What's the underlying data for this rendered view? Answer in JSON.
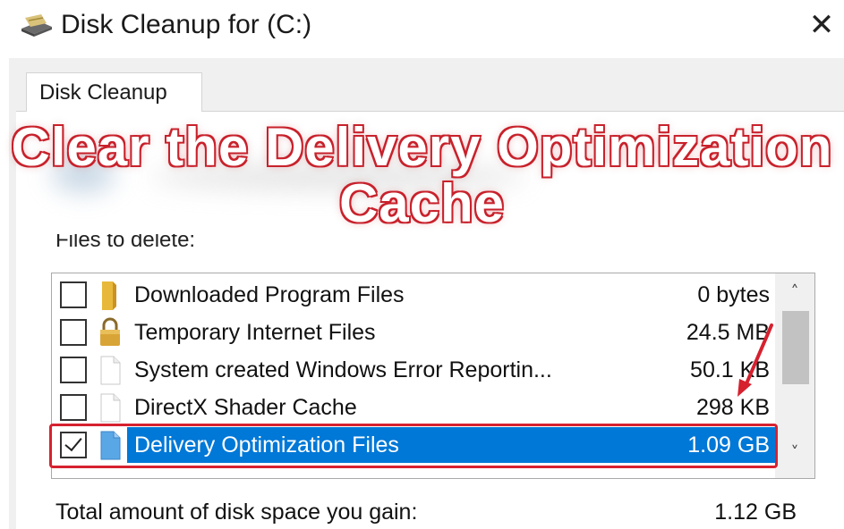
{
  "window": {
    "title": "Disk Cleanup for  (C:)",
    "close_glyph": "✕",
    "app_icon": "disk-cleanup-icon"
  },
  "tab": {
    "label": "Disk Cleanup"
  },
  "overlay": {
    "line1": "Clear the Delivery Optimization",
    "line2": "Cache",
    "stroke_color": "#c8222c"
  },
  "files_to_delete_label": "Files to delete:",
  "files": [
    {
      "name": "Downloaded Program Files",
      "size": "0 bytes",
      "checked": false,
      "icon": "folder-icon"
    },
    {
      "name": "Temporary Internet Files",
      "size": "24.5 MB",
      "checked": false,
      "icon": "lock-icon"
    },
    {
      "name": "System created Windows Error Reportin...",
      "size": "50.1 KB",
      "checked": false,
      "icon": "document-icon"
    },
    {
      "name": "DirectX Shader Cache",
      "size": "298 KB",
      "checked": false,
      "icon": "document-icon"
    },
    {
      "name": "Delivery Optimization Files",
      "size": "1.09 GB",
      "checked": true,
      "selected": true,
      "icon": "document-blue-icon"
    }
  ],
  "scrollbar": {
    "up_glyph": "˄",
    "down_glyph": "˅"
  },
  "total": {
    "label": "Total amount of disk space you gain:",
    "value": "1.12 GB"
  },
  "colors": {
    "selection": "#0078d7",
    "highlight_border": "#d6212f",
    "arrow": "#d6212f"
  }
}
